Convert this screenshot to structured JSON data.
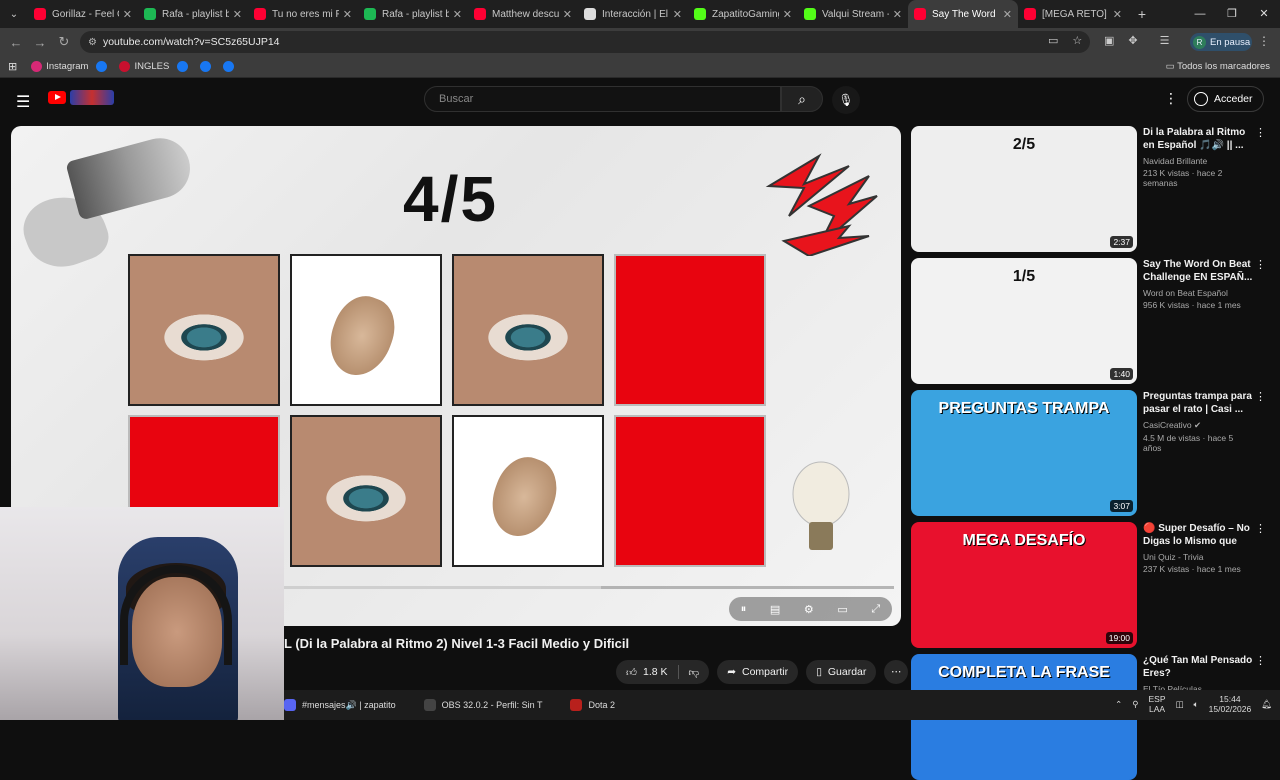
{
  "browser": {
    "tabs": [
      {
        "title": "Gorillaz - Feel Good",
        "fav_color": "#ff0033"
      },
      {
        "title": "Rafa - playlist by",
        "fav_color": "#1db954"
      },
      {
        "title": "Tu no eres mi Papá",
        "fav_color": "#ff0033"
      },
      {
        "title": "Rafa - playlist by",
        "fav_color": "#1db954"
      },
      {
        "title": "Matthew descubre",
        "fav_color": "#ff0033"
      },
      {
        "title": "Interacción | El mi",
        "fav_color": "#dddddd"
      },
      {
        "title": "ZapatitoGaming S",
        "fav_color": "#53fc18"
      },
      {
        "title": "Valqui Stream - W",
        "fav_color": "#53fc18"
      },
      {
        "title": "Say The Word",
        "fav_color": "#ff0033"
      },
      {
        "title": "[MEGA RETO] Di L",
        "fav_color": "#ff0033"
      }
    ],
    "url": "youtube.com/watch?v=SC5z65UJP14",
    "profile_initial": "R",
    "profile_status": "En pausa",
    "bookmarks": [
      {
        "label": "Instagram",
        "color": "#d62976"
      },
      {
        "label": "",
        "color": "#1877f2"
      },
      {
        "label": "INGLES",
        "color": "#c8102e"
      },
      {
        "label": "",
        "color": "#1877f2"
      },
      {
        "label": "",
        "color": "#1877f2"
      },
      {
        "label": "",
        "color": "#1877f2"
      }
    ],
    "all_bookmarks": "Todos los marcadores"
  },
  "youtube": {
    "search_placeholder": "Buscar",
    "signin_label": "Acceder",
    "video": {
      "score": "4/5",
      "title": "L (Di la Palabra al Ritmo 2) Nivel 1-3 Facil Medio y Dificil",
      "likes": "1.8 K",
      "share": "Compartir",
      "save": "Guardar",
      "progress": 0.52,
      "grid": [
        "eye",
        "louse",
        "eye",
        "red",
        "red",
        "eye",
        "louse",
        "red"
      ]
    },
    "recommendations": [
      {
        "title": "Di la Palabra al Ritmo en Español 🎵🔊 || ...",
        "channel": "Navidad Brillante",
        "stats": "213 K vistas · hace 2 semanas",
        "duration": "2:37",
        "thumb_bg": "#eeeeee",
        "thumb_label": "2/5"
      },
      {
        "title": "Say The Word On Beat Challenge EN ESPAÑ...",
        "channel": "Word on Beat Español",
        "stats": "956 K vistas · hace 1 mes",
        "duration": "1:40",
        "thumb_bg": "#f2f2f2",
        "thumb_label": "1/5"
      },
      {
        "title": "Preguntas trampa para pasar el rato | Casi ...",
        "channel": "CasiCreativo ✔",
        "stats": "4.5 M de vistas · hace 5 años",
        "duration": "3:07",
        "thumb_bg": "#3aa3e0",
        "thumb_label": "PREGUNTAS TRAMPA"
      },
      {
        "title": "🔴 Super Desafío – No Digas lo Mismo que Y...",
        "channel": "Uni Quiz - Trivia",
        "stats": "237 K vistas · hace 1 mes",
        "duration": "19:00",
        "thumb_bg": "#e8112d",
        "thumb_label": "MEGA DESAFÍO"
      },
      {
        "title": "¿Qué Tan Mal Pensado Eres?",
        "channel": "El Tío Películas",
        "stats": "",
        "duration": "",
        "thumb_bg": "#2a7de1",
        "thumb_label": "COMPLETA LA FRASE"
      }
    ]
  },
  "taskbar": {
    "items": [
      {
        "label": "#mensajes🔊 | zapatito",
        "color": "#5865f2"
      },
      {
        "label": "OBS 32.0.2 - Perfil: Sin T",
        "color": "#444444"
      },
      {
        "label": "Dota 2",
        "color": "#b8201c"
      }
    ],
    "lang": "ESP",
    "lang_sub": "LAA",
    "time": "15:44",
    "date": "15/02/2026"
  }
}
